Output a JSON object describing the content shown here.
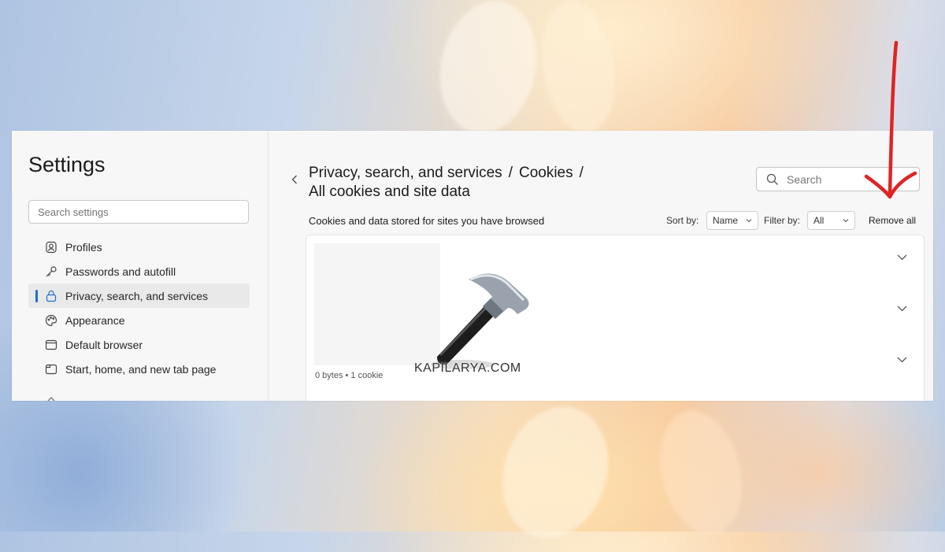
{
  "sidebar": {
    "title": "Settings",
    "search_placeholder": "Search settings",
    "items": [
      {
        "label": "Profiles",
        "icon": "profile-icon"
      },
      {
        "label": "Passwords and autofill",
        "icon": "key-icon"
      },
      {
        "label": "Privacy, search, and services",
        "icon": "lock-icon",
        "active": true
      },
      {
        "label": "Appearance",
        "icon": "palette-icon"
      },
      {
        "label": "Default browser",
        "icon": "browser-icon"
      },
      {
        "label": "Start, home, and new tab page",
        "icon": "home-tab-icon"
      }
    ]
  },
  "header": {
    "breadcrumb_1": "Privacy, search, and services",
    "breadcrumb_2": "Cookies",
    "breadcrumb_3": "All cookies and site data",
    "separator": "/",
    "search_placeholder": "Search"
  },
  "toolbar": {
    "subtitle": "Cookies and data stored for sites you have browsed",
    "sort_label": "Sort by:",
    "sort_value": "Name",
    "filter_label": "Filter by:",
    "filter_value": "All",
    "remove_all": "Remove all"
  },
  "cookie_list": {
    "row_meta": "0 bytes • 1 cookie"
  },
  "watermark": {
    "text": "KAPILARYA.COM"
  },
  "colors": {
    "accent": "#1f6fd1",
    "annotation_arrow": "#e02424"
  }
}
